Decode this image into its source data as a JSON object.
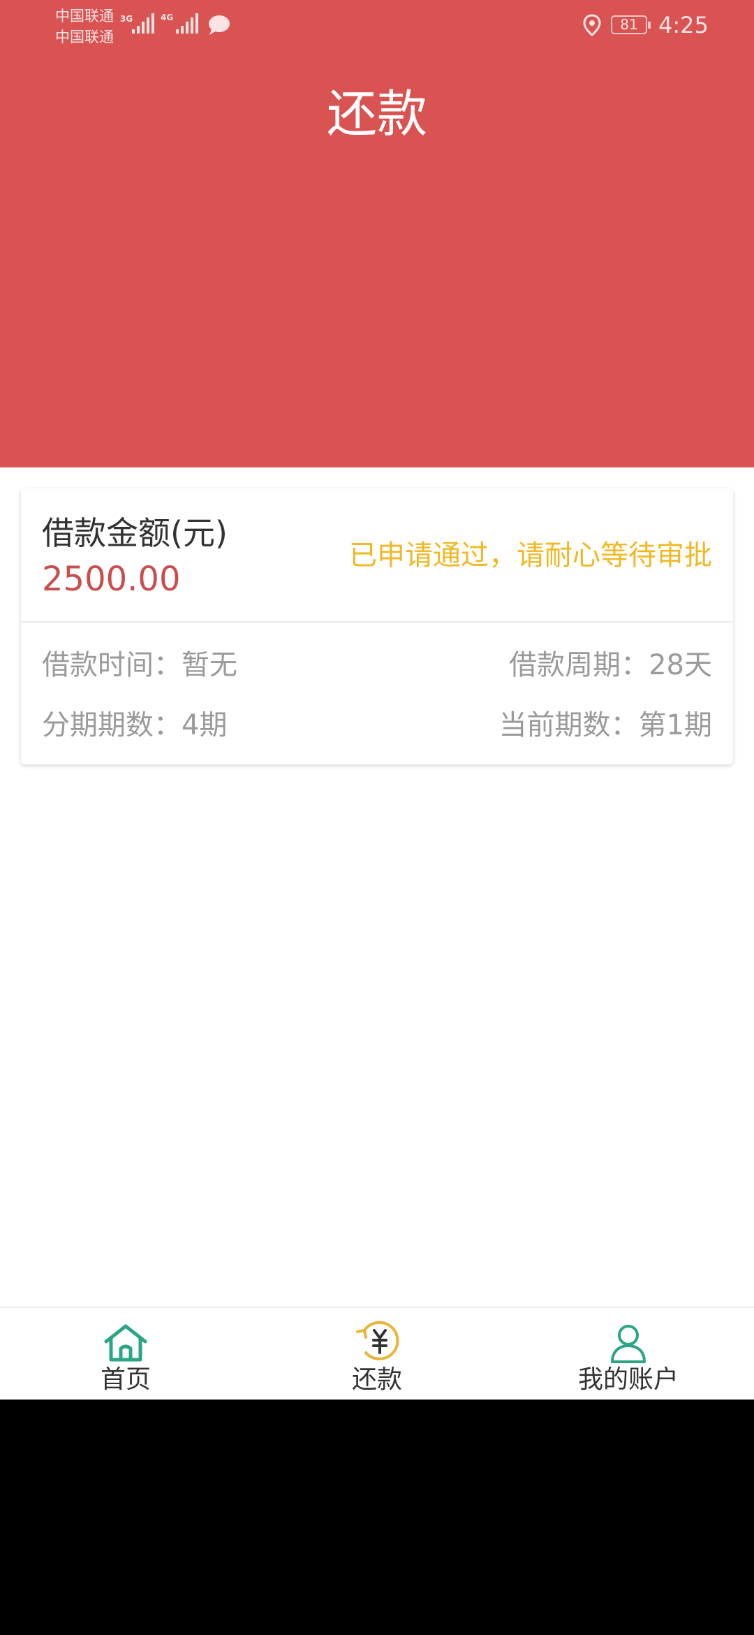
{
  "status_bar": {
    "carrier_1": "中国联通",
    "carrier_2": "中国联通",
    "network_1": "3G",
    "network_2": "4G",
    "battery": "81",
    "time": "4:25"
  },
  "header": {
    "title": "还款"
  },
  "loan_card": {
    "amount_label": "借款金额(元)",
    "amount_value": "2500.00",
    "status": "已申请通过，请耐心等待审批",
    "loan_time": "借款时间：暂无",
    "loan_period": "借款周期：28天",
    "installments": "分期期数：4期",
    "current_period": "当前期数：第1期"
  },
  "tabbar": {
    "tabs": [
      {
        "label": "首页",
        "icon": "home-icon"
      },
      {
        "label": "还款",
        "icon": "repay-yuan-icon"
      },
      {
        "label": "我的账户",
        "icon": "user-icon"
      }
    ]
  },
  "colors": {
    "header_red": "#d95353",
    "amount_red": "#c94d4d",
    "status_yellow": "#f0b823",
    "tab_green": "#2aa585",
    "tab_gold": "#e8b43a"
  }
}
